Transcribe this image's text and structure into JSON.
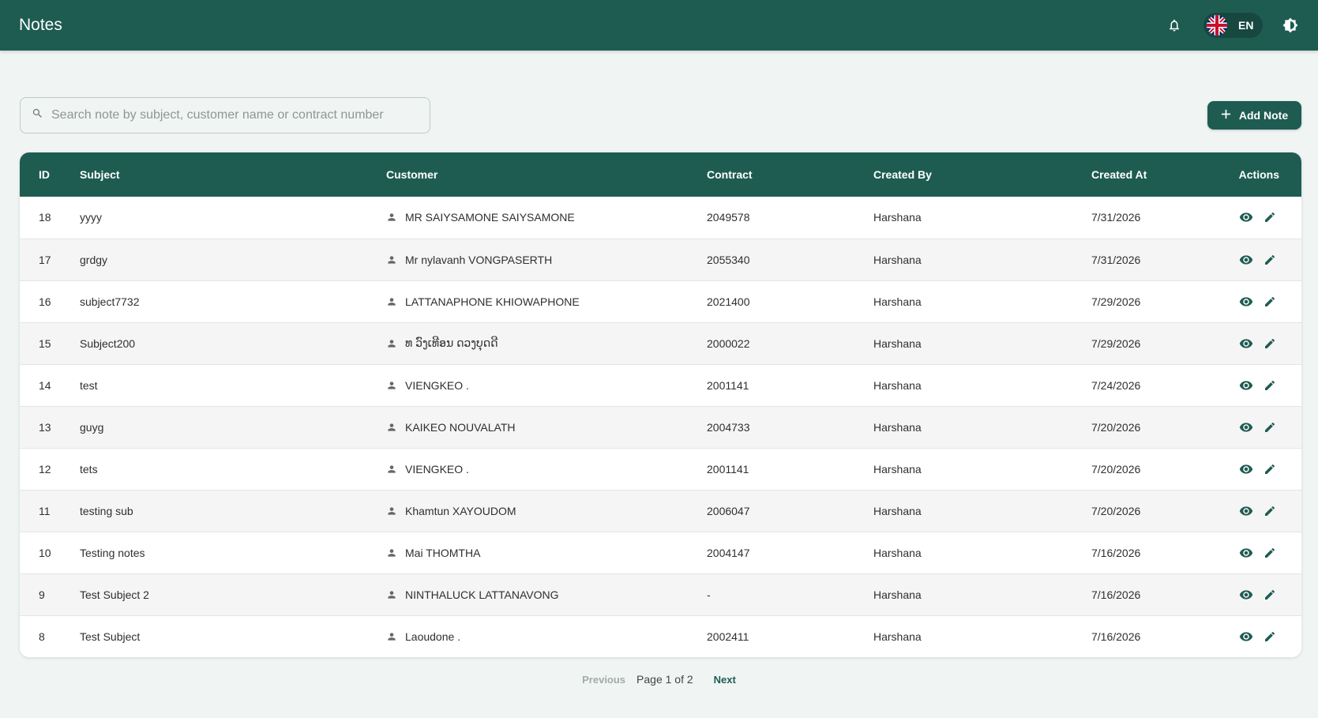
{
  "header": {
    "title": "Notes",
    "language": "EN",
    "icons": [
      "bell-icon",
      "uk-flag-icon",
      "theme-toggle-icon"
    ]
  },
  "toolbar": {
    "search_placeholder": "Search note by subject, customer name or contract number",
    "search_value": "",
    "add_label": "Add Note"
  },
  "table": {
    "columns": [
      "ID",
      "Subject",
      "Customer",
      "Contract",
      "Created By",
      "Created At",
      "Actions"
    ],
    "rows": [
      {
        "id": "18",
        "subject": "yyyy",
        "customer": "MR SAIYSAMONE SAIYSAMONE",
        "contract": "2049578",
        "created_by": "Harshana",
        "created_at": "7/31/2026"
      },
      {
        "id": "17",
        "subject": "grdgy",
        "customer": "Mr nylavanh VONGPASERTH",
        "contract": "2055340",
        "created_by": "Harshana",
        "created_at": "7/31/2026"
      },
      {
        "id": "16",
        "subject": "subject7732",
        "customer": "LATTANAPHONE KHIOWAPHONE",
        "contract": "2021400",
        "created_by": "Harshana",
        "created_at": "7/29/2026"
      },
      {
        "id": "15",
        "subject": "Subject200",
        "customer": "ທ ວົງເທີອນ ດວງບຸດດີ",
        "contract": "2000022",
        "created_by": "Harshana",
        "created_at": "7/29/2026"
      },
      {
        "id": "14",
        "subject": "test",
        "customer": "VIENGKEO .",
        "contract": "2001141",
        "created_by": "Harshana",
        "created_at": "7/24/2026"
      },
      {
        "id": "13",
        "subject": "guyg",
        "customer": "KAIKEO NOUVALATH",
        "contract": "2004733",
        "created_by": "Harshana",
        "created_at": "7/20/2026"
      },
      {
        "id": "12",
        "subject": "tets",
        "customer": "VIENGKEO .",
        "contract": "2001141",
        "created_by": "Harshana",
        "created_at": "7/20/2026"
      },
      {
        "id": "11",
        "subject": "testing sub",
        "customer": "Khamtun XAYOUDOM",
        "contract": "2006047",
        "created_by": "Harshana",
        "created_at": "7/20/2026"
      },
      {
        "id": "10",
        "subject": "Testing notes",
        "customer": "Mai THOMTHA",
        "contract": "2004147",
        "created_by": "Harshana",
        "created_at": "7/16/2026"
      },
      {
        "id": "9",
        "subject": "Test Subject 2",
        "customer": "NINTHALUCK LATTANAVONG",
        "contract": "-",
        "created_by": "Harshana",
        "created_at": "7/16/2026"
      },
      {
        "id": "8",
        "subject": "Test Subject",
        "customer": "Laoudone .",
        "contract": "2002411",
        "created_by": "Harshana",
        "created_at": "7/16/2026"
      }
    ],
    "row_icons": [
      "person-icon",
      "eye-icon",
      "pencil-icon"
    ]
  },
  "pagination": {
    "previous": "Previous",
    "info": "Page 1 of 2",
    "next": "Next"
  },
  "colors": {
    "primary": "#1e5c52",
    "background": "#f0f5f3",
    "alt_row": "#f5f5f5"
  }
}
